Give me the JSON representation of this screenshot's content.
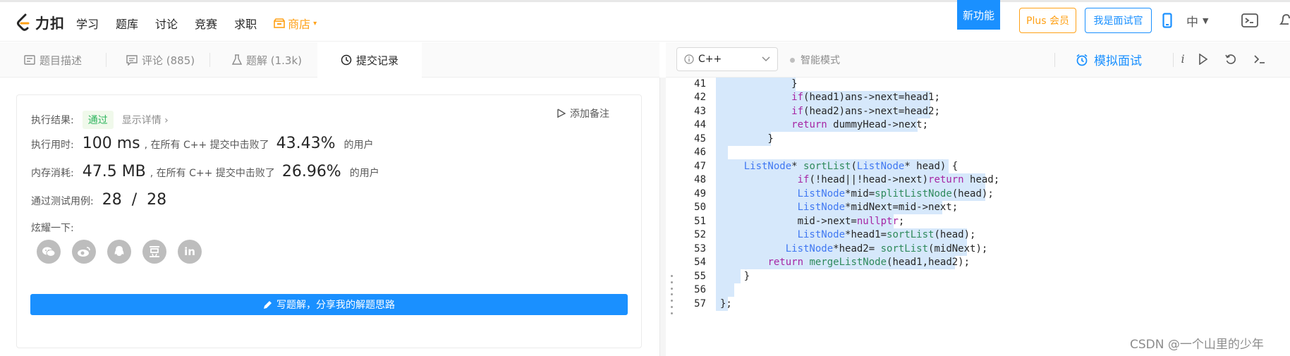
{
  "nav": {
    "logo_text": "力扣",
    "links": [
      "学习",
      "题库",
      "讨论",
      "竞赛",
      "求职"
    ],
    "store": "商店",
    "new_feature": "新功能",
    "plus": "Plus 会员",
    "interviewer": "我是面试官",
    "lang_switch": "中"
  },
  "left_tabs": [
    {
      "label": "题目描述",
      "icon": "description-icon"
    },
    {
      "label": "评论 (885)",
      "icon": "comment-icon"
    },
    {
      "label": "题解 (1.3k)",
      "icon": "flask-icon"
    },
    {
      "label": "提交记录",
      "icon": "clock-icon"
    }
  ],
  "result": {
    "result_label": "执行结果:",
    "status": "通过",
    "detail": "显示详情 ›",
    "add_note": "添加备注",
    "runtime_label": "执行用时:",
    "runtime_value": "100 ms",
    "runtime_text": ", 在所有 C++ 提交中击败了",
    "runtime_pct": "43.43%",
    "runtime_suffix": "的用户",
    "memory_label": "内存消耗:",
    "memory_value": "47.5 MB",
    "memory_text": ", 在所有 C++ 提交中击败了",
    "memory_pct": "26.96%",
    "memory_suffix": "的用户",
    "tests_label": "通过测试用例:",
    "tests_value": "28  /  28",
    "share_label": "炫耀一下:",
    "share_icons": [
      "wechat-icon",
      "weibo-icon",
      "qq-icon",
      "douban-icon",
      "linkedin-icon"
    ],
    "write_button": "写题解，分享我的解题思路"
  },
  "editor": {
    "language": "C++",
    "smart_mode": "智能模式",
    "mock_interview": "模拟面试",
    "lines": [
      {
        "n": "41",
        "text": "            }"
      },
      {
        "n": "42",
        "text": "            if(head1)ans->next=head1;"
      },
      {
        "n": "43",
        "text": "            if(head2)ans->next=head2;"
      },
      {
        "n": "44",
        "text": "            return dummyHead->next;"
      },
      {
        "n": "45",
        "text": "        }"
      },
      {
        "n": "46",
        "text": ""
      },
      {
        "n": "47",
        "text": "    ListNode* sortList(ListNode* head) {"
      },
      {
        "n": "48",
        "text": "             if(!head||!head->next)return head;"
      },
      {
        "n": "49",
        "text": "             ListNode*mid=splitListNode(head);"
      },
      {
        "n": "50",
        "text": "             ListNode*midNext=mid->next;"
      },
      {
        "n": "51",
        "text": "             mid->next=nullptr;"
      },
      {
        "n": "52",
        "text": "             ListNode*head1=sortList(head);"
      },
      {
        "n": "53",
        "text": "           ListNode*head2= sortList(midNext);"
      },
      {
        "n": "54",
        "text": "        return mergeListNode(head1,head2);"
      },
      {
        "n": "55",
        "text": "    }"
      },
      {
        "n": "56",
        "text": ""
      },
      {
        "n": "57",
        "text": "};"
      }
    ]
  },
  "watermark": "CSDN @一个山里的少年",
  "colors": {
    "accent": "#1a90ff",
    "store": "#ffa116",
    "pass": "#2db55d",
    "selection": "#d6e8fb"
  }
}
